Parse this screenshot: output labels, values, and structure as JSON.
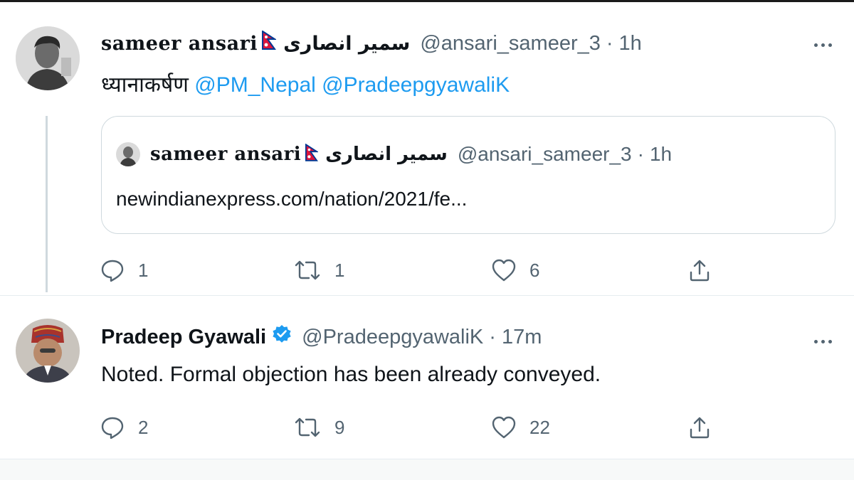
{
  "tweets": [
    {
      "display_name": "sameer ansari",
      "display_name_urdu": "سمیر انصاری",
      "handle": "@ansari_sameer_3",
      "separator": "·",
      "time": "1h",
      "text": "ध्यानाकर्षण",
      "mentions": [
        "@PM_Nepal",
        "@PradeepgyawaliK"
      ],
      "quoted": {
        "display_name": "sameer ansari",
        "display_name_urdu": "سمیر انصاری",
        "handle": "@ansari_sameer_3",
        "separator": "·",
        "time": "1h",
        "link_text": "newindianexpress.com/nation/2021/fe..."
      },
      "actions": {
        "replies": "1",
        "retweets": "1",
        "likes": "6"
      }
    },
    {
      "display_name": "Pradeep Gyawali",
      "handle": "@PradeepgyawaliK",
      "separator": "·",
      "time": "17m",
      "verified": true,
      "text": "Noted. Formal objection has been already conveyed.",
      "actions": {
        "replies": "2",
        "retweets": "9",
        "likes": "22"
      }
    }
  ],
  "icons": {
    "flag": "nepal-flag-icon",
    "verified": "verified-badge-icon",
    "reply": "reply-icon",
    "retweet": "retweet-icon",
    "like": "like-icon",
    "share": "share-icon",
    "more": "more-options-icon"
  },
  "colors": {
    "text": "#0f1419",
    "secondary": "#536471",
    "link": "#1d9bf0",
    "border": "#cfd9de",
    "verified": "#1d9bf0",
    "flag_red": "#dc143c",
    "flag_blue": "#003893"
  }
}
